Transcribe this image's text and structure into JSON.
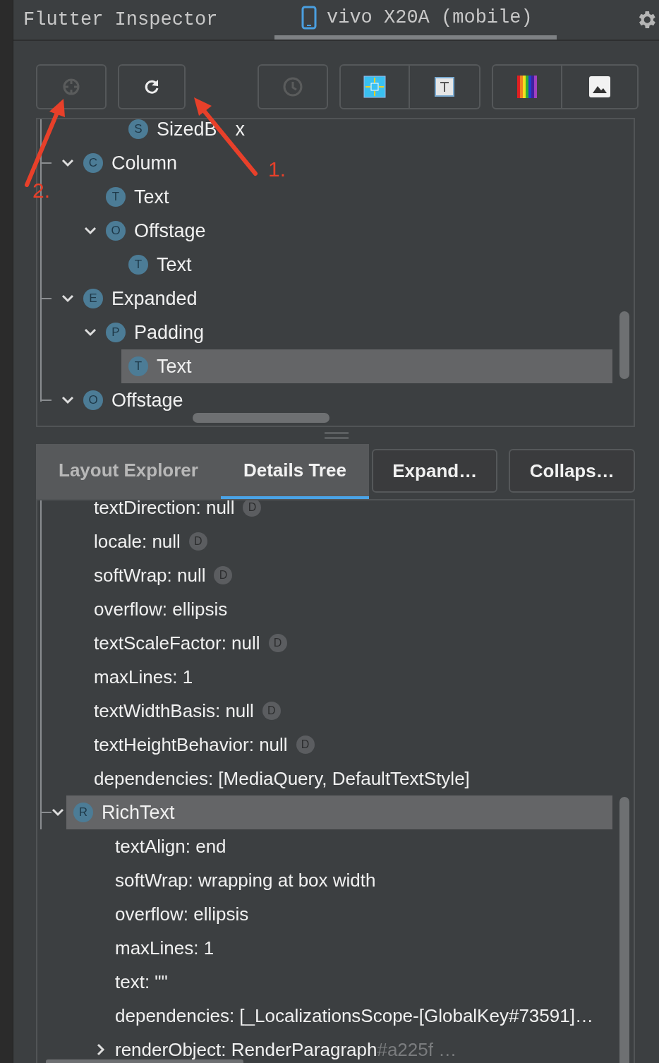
{
  "header": {
    "title": "Flutter Inspector",
    "device_tab": {
      "label": "vivo X20A (mobile)",
      "selected": true
    }
  },
  "toolbar": [
    {
      "disabled": true
    },
    {
      "disabled": false
    },
    {
      "disabled": true
    },
    {
      "disabled": false
    },
    {
      "disabled": false
    },
    {
      "disabled": false
    },
    {
      "disabled": false
    }
  ],
  "widget_tree": [
    {
      "children": [
        {
          "children": [
            {
              "label": "SizedB",
              "label_tail": "x",
              "badge": "S",
              "selected": false
            }
          ]
        }
      ]
    },
    {
      "label": "Column",
      "badge": "C",
      "expanded": true,
      "selected": false,
      "children": [
        {
          "label": "Text",
          "badge": "T",
          "selected": false
        },
        {
          "label": "Offstage",
          "badge": "O",
          "expanded": true,
          "selected": false,
          "children": [
            {
              "label": "Text",
              "badge": "T",
              "selected": false
            }
          ]
        }
      ]
    },
    {
      "label": "Expanded",
      "badge": "E",
      "expanded": true,
      "selected": false,
      "children": [
        {
          "label": "Padding",
          "badge": "P",
          "expanded": true,
          "selected": false,
          "children": [
            {
              "label": "Text",
              "badge": "T",
              "selected": true
            }
          ]
        }
      ]
    },
    {
      "label": "Offstage",
      "badge": "O",
      "expanded": true,
      "selected": false
    }
  ],
  "tabs": [
    {
      "label": "Layout Explorer",
      "selected": false
    },
    {
      "label": "Details Tree",
      "selected": true
    }
  ],
  "buttons": [
    "Expand…",
    "Collaps…"
  ],
  "details_tree": [
    {
      "kind": "property",
      "text": "textDirection: null",
      "default_badge": "D"
    },
    {
      "kind": "property",
      "text": "locale: null",
      "default_badge": "D"
    },
    {
      "kind": "property",
      "text": "softWrap: null",
      "default_badge": "D"
    },
    {
      "kind": "property",
      "text": "overflow: ellipsis"
    },
    {
      "kind": "property",
      "text": "textScaleFactor: null",
      "default_badge": "D"
    },
    {
      "kind": "property",
      "text": "maxLines: 1"
    },
    {
      "kind": "property",
      "text": "textWidthBasis: null",
      "default_badge": "D"
    },
    {
      "kind": "property",
      "text": "textHeightBehavior: null",
      "default_badge": "D"
    },
    {
      "kind": "property",
      "text": "dependencies: [MediaQuery, DefaultTextStyle]"
    },
    {
      "kind": "node",
      "label": "RichText",
      "badge": "R",
      "expanded": true,
      "selected": true,
      "children": [
        {
          "kind": "property",
          "text": "textAlign: end"
        },
        {
          "kind": "property",
          "text": "softWrap: wrapping at box width"
        },
        {
          "kind": "property",
          "text": "overflow: ellipsis"
        },
        {
          "kind": "property",
          "text": "maxLines: 1"
        },
        {
          "kind": "property",
          "text": "text: \"\""
        },
        {
          "kind": "property",
          "text": "dependencies: [_LocalizationsScope-[GlobalKey#73591]…"
        },
        {
          "kind": "property",
          "text": "renderObject: RenderParagraph",
          "secondary": "#a225f …",
          "expanded": false
        }
      ]
    }
  ],
  "annotations": [
    {
      "label": "1."
    },
    {
      "label": "2."
    }
  ]
}
